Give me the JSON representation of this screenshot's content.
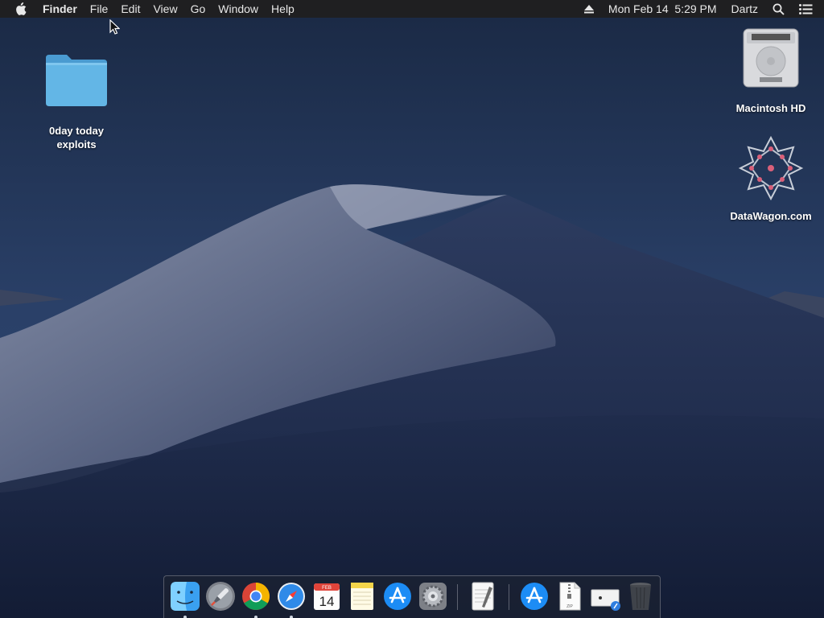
{
  "menubar": {
    "apple_icon": "apple-logo-icon",
    "app_name": "Finder",
    "menus": [
      "File",
      "Edit",
      "View",
      "Go",
      "Window",
      "Help"
    ],
    "eject_icon": "eject-icon",
    "datetime": "Mon Feb 14  5:29 PM",
    "user": "Dartz",
    "search_icon": "spotlight-search-icon",
    "notifications_icon": "notification-center-icon"
  },
  "desktop_icons": {
    "folder": {
      "label_line1": "0day today",
      "label_line2": "exploits",
      "icon": "folder-icon"
    },
    "drive": {
      "label": "Macintosh HD",
      "icon": "hard-drive-icon"
    },
    "datawagon": {
      "label": "DataWagon.com",
      "icon": "star-pattern-icon"
    }
  },
  "dock": {
    "items": [
      {
        "name": "Finder",
        "icon": "finder-icon",
        "running": true
      },
      {
        "name": "Launchpad",
        "icon": "launchpad-rocket-icon",
        "running": false
      },
      {
        "name": "Google Chrome",
        "icon": "chrome-icon",
        "running": true
      },
      {
        "name": "Safari",
        "icon": "safari-compass-icon",
        "running": true
      },
      {
        "name": "Calendar",
        "icon": "calendar-icon",
        "running": false,
        "month": "FEB",
        "day": "14"
      },
      {
        "name": "Notes",
        "icon": "notes-icon",
        "running": false
      },
      {
        "name": "App Store",
        "icon": "app-store-icon",
        "running": false
      },
      {
        "name": "System Preferences",
        "icon": "gear-icon",
        "running": false
      },
      {
        "name": "TextEdit",
        "icon": "textedit-icon",
        "running": false
      },
      {
        "name": "Applications",
        "icon": "applications-folder-icon",
        "running": false
      },
      {
        "name": "Archive",
        "icon": "zip-file-icon",
        "running": false,
        "tag": "ZIP"
      },
      {
        "name": "Downloads",
        "icon": "downloads-stack-icon",
        "running": false
      },
      {
        "name": "Trash",
        "icon": "trash-icon",
        "running": false
      }
    ]
  },
  "colors": {
    "menubar_bg": "#1f1f21",
    "menubar_text": "#e8e8e8",
    "folder_blue": "#5fb2e3",
    "sky_dark": "#1b2a44"
  }
}
